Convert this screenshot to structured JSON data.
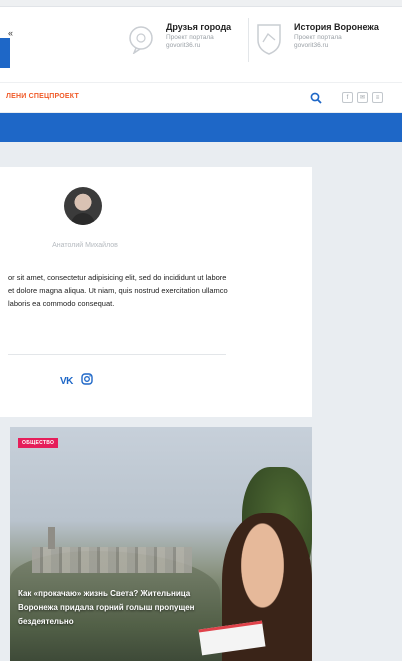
{
  "header": {
    "partners": [
      {
        "name": "Друзья города",
        "subtitle": "Проект портала govorit36.ru"
      },
      {
        "name": "История Воронежа",
        "subtitle": "Проект портала govorit36.ru"
      }
    ],
    "left_arrow": "«"
  },
  "nav": {
    "special_label": "ЛЕНИ СПЕЦПРОЕКТ",
    "mini_buttons": [
      "f",
      "✉",
      "≡"
    ]
  },
  "author": {
    "name": "Анатолий Михайлов",
    "bio": "or sit amet, consectetur adipisicing elit, sed do incididunt ut labore et dolore magna aliqua. Ut niam, quis nostrud exercitation ullamco laboris ea commodo consequat.",
    "social": {
      "vk": "VK",
      "instagram": "instagram"
    }
  },
  "news": {
    "badge": "ОБЩЕСТВО",
    "title": "Как «прокачаю» жизнь Света? Жительница Воронежа придала горний голыш пропущен бездеятельно"
  },
  "colors": {
    "accent_blue": "#1e67c7",
    "accent_orange": "#f05a28",
    "badge_pink": "#e51e5a"
  }
}
